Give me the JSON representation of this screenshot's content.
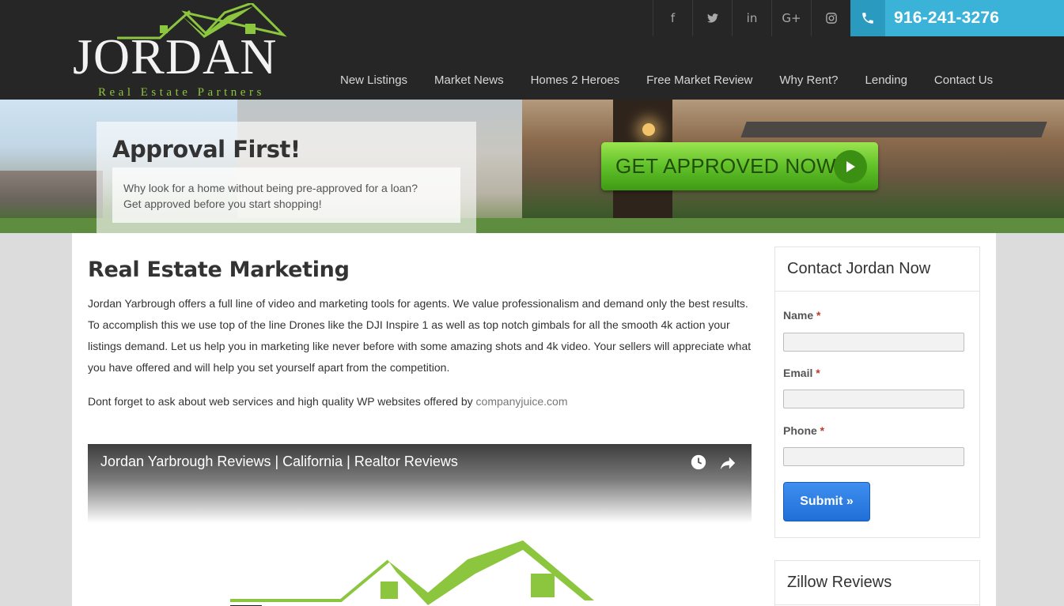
{
  "header": {
    "logo": {
      "word": "JORDAN",
      "tagline": "Real Estate Partners"
    },
    "social": [
      {
        "icon": "facebook-icon",
        "glyph": "f"
      },
      {
        "icon": "twitter-icon",
        "glyph": "🐦"
      },
      {
        "icon": "linkedin-icon",
        "glyph": "in"
      },
      {
        "icon": "google-plus-icon",
        "glyph": "G+"
      },
      {
        "icon": "instagram-icon",
        "glyph": "◎"
      }
    ],
    "phone": "916-241-3276",
    "nav": [
      "New Listings",
      "Market News",
      "Homes 2 Heroes",
      "Free Market Review",
      "Why Rent?",
      "Lending",
      "Contact Us"
    ]
  },
  "hero": {
    "title": "Approval First!",
    "subtitle_line1": "Why look for a home without being pre-approved for a loan?",
    "subtitle_line2": "Get approved before you start shopping!",
    "cta_label": "GET APPROVED NOW"
  },
  "main": {
    "title": "Real Estate Marketing",
    "paragraph": "Jordan Yarbrough offers a full line of video and marketing tools for agents. We value professionalism and demand only the best results. To accomplish this we use top of the line Drones like the DJI Inspire 1 as well as top notch gimbals for all the smooth 4k action your listings demand.  Let us help you in marketing like never before with some amazing shots and 4k video. Your sellers will appreciate what you have offered and will help you set yourself apart from the competition.",
    "paragraph2_prefix": "Dont forget to ask about web services and high quality WP websites offered by ",
    "paragraph2_link": "companyjuice.com",
    "video_title": "Jordan Yarbrough Reviews | California | Realtor Reviews"
  },
  "sidebar": {
    "contact_title": "Contact Jordan Now",
    "name_label": "Name",
    "email_label": "Email",
    "phone_label": "Phone",
    "required_mark": "*",
    "submit_label": "Submit »",
    "zillow_title": "Zillow Reviews"
  },
  "colors": {
    "header_bg": "#262626",
    "phone_bg": "#3bb3d9",
    "brand_green": "#8cc63f",
    "cta_green": "#62c22a",
    "submit_blue": "#1f6fd8"
  }
}
